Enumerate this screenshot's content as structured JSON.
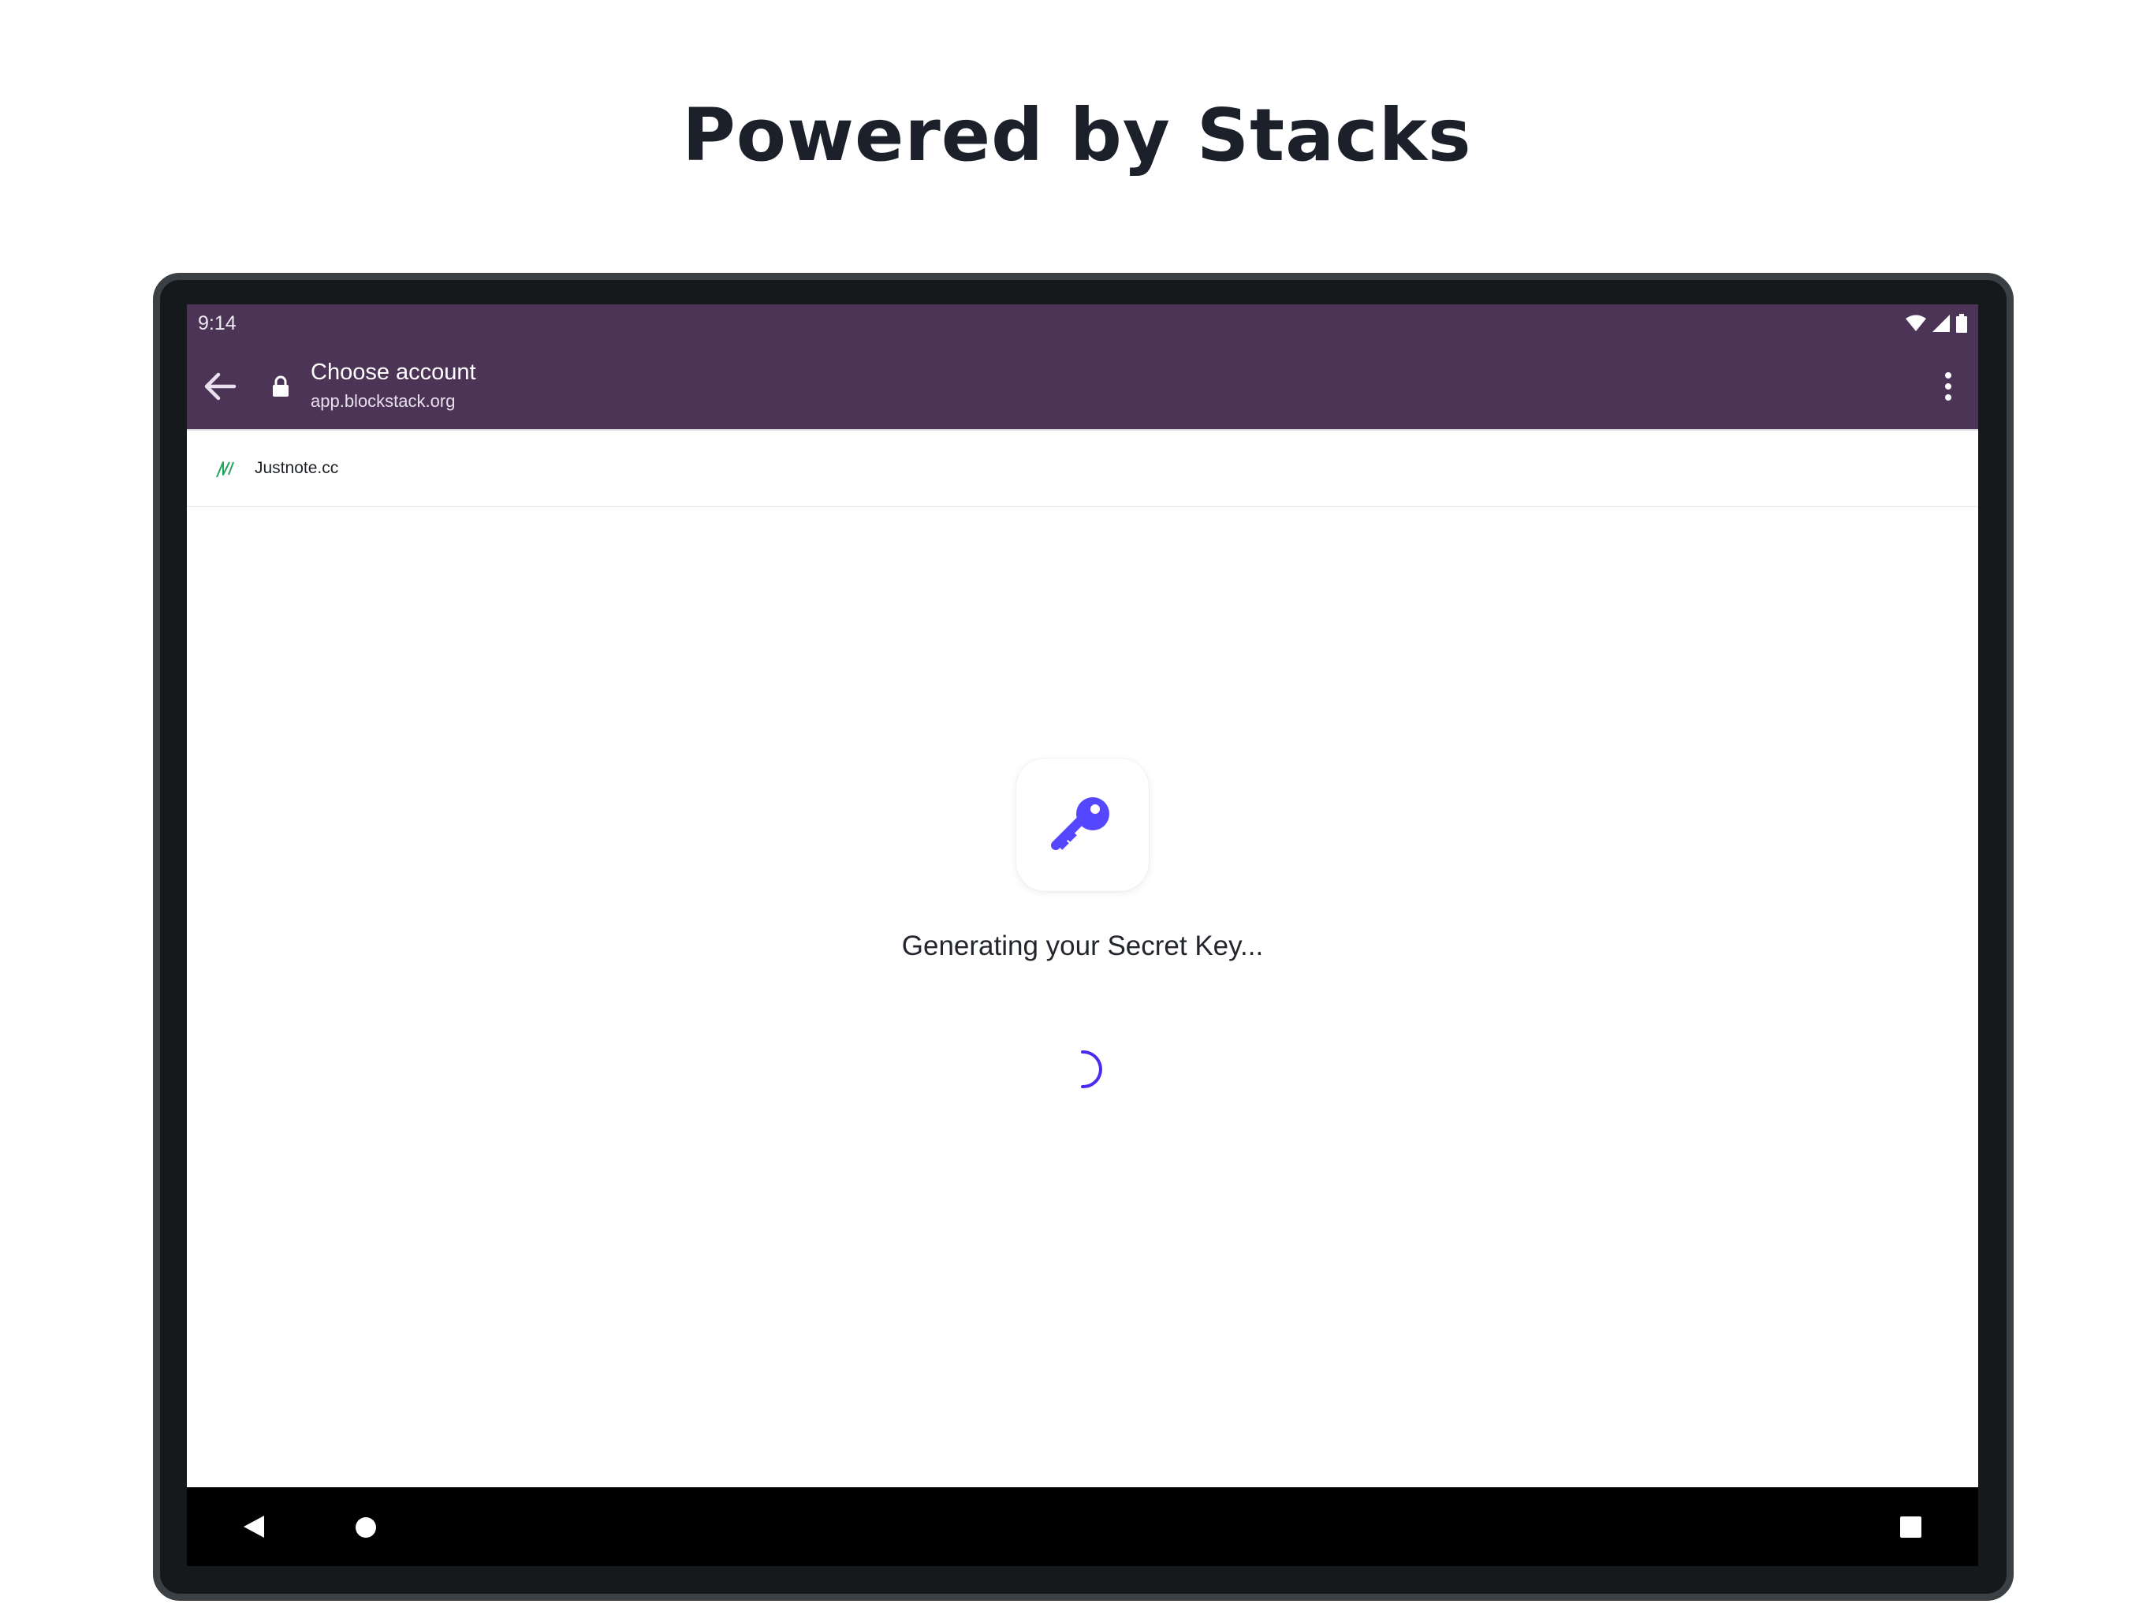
{
  "headline": "Powered by Stacks",
  "status_bar": {
    "time": "9:14",
    "icons": [
      "wifi-icon",
      "signal-icon",
      "battery-icon"
    ]
  },
  "app_bar": {
    "back_icon": "arrow-back-icon",
    "lock_icon": "lock-icon",
    "title": "Choose account",
    "url": "app.blockstack.org",
    "menu_icon": "more-vert-icon"
  },
  "app_header": {
    "logo_icon": "justnote-logo-icon",
    "name": "Justnote.cc"
  },
  "main": {
    "key_icon": "key-icon",
    "status_text": "Generating your Secret Key...",
    "spinner_icon": "loading-spinner-icon"
  },
  "nav_bar": {
    "back": "nav-back-icon",
    "home": "nav-home-icon",
    "recents": "nav-recents-icon"
  },
  "colors": {
    "app_bar": "#4c3457",
    "accent": "#5546ff",
    "headline": "#1b202b",
    "logo": "#22a45d"
  }
}
